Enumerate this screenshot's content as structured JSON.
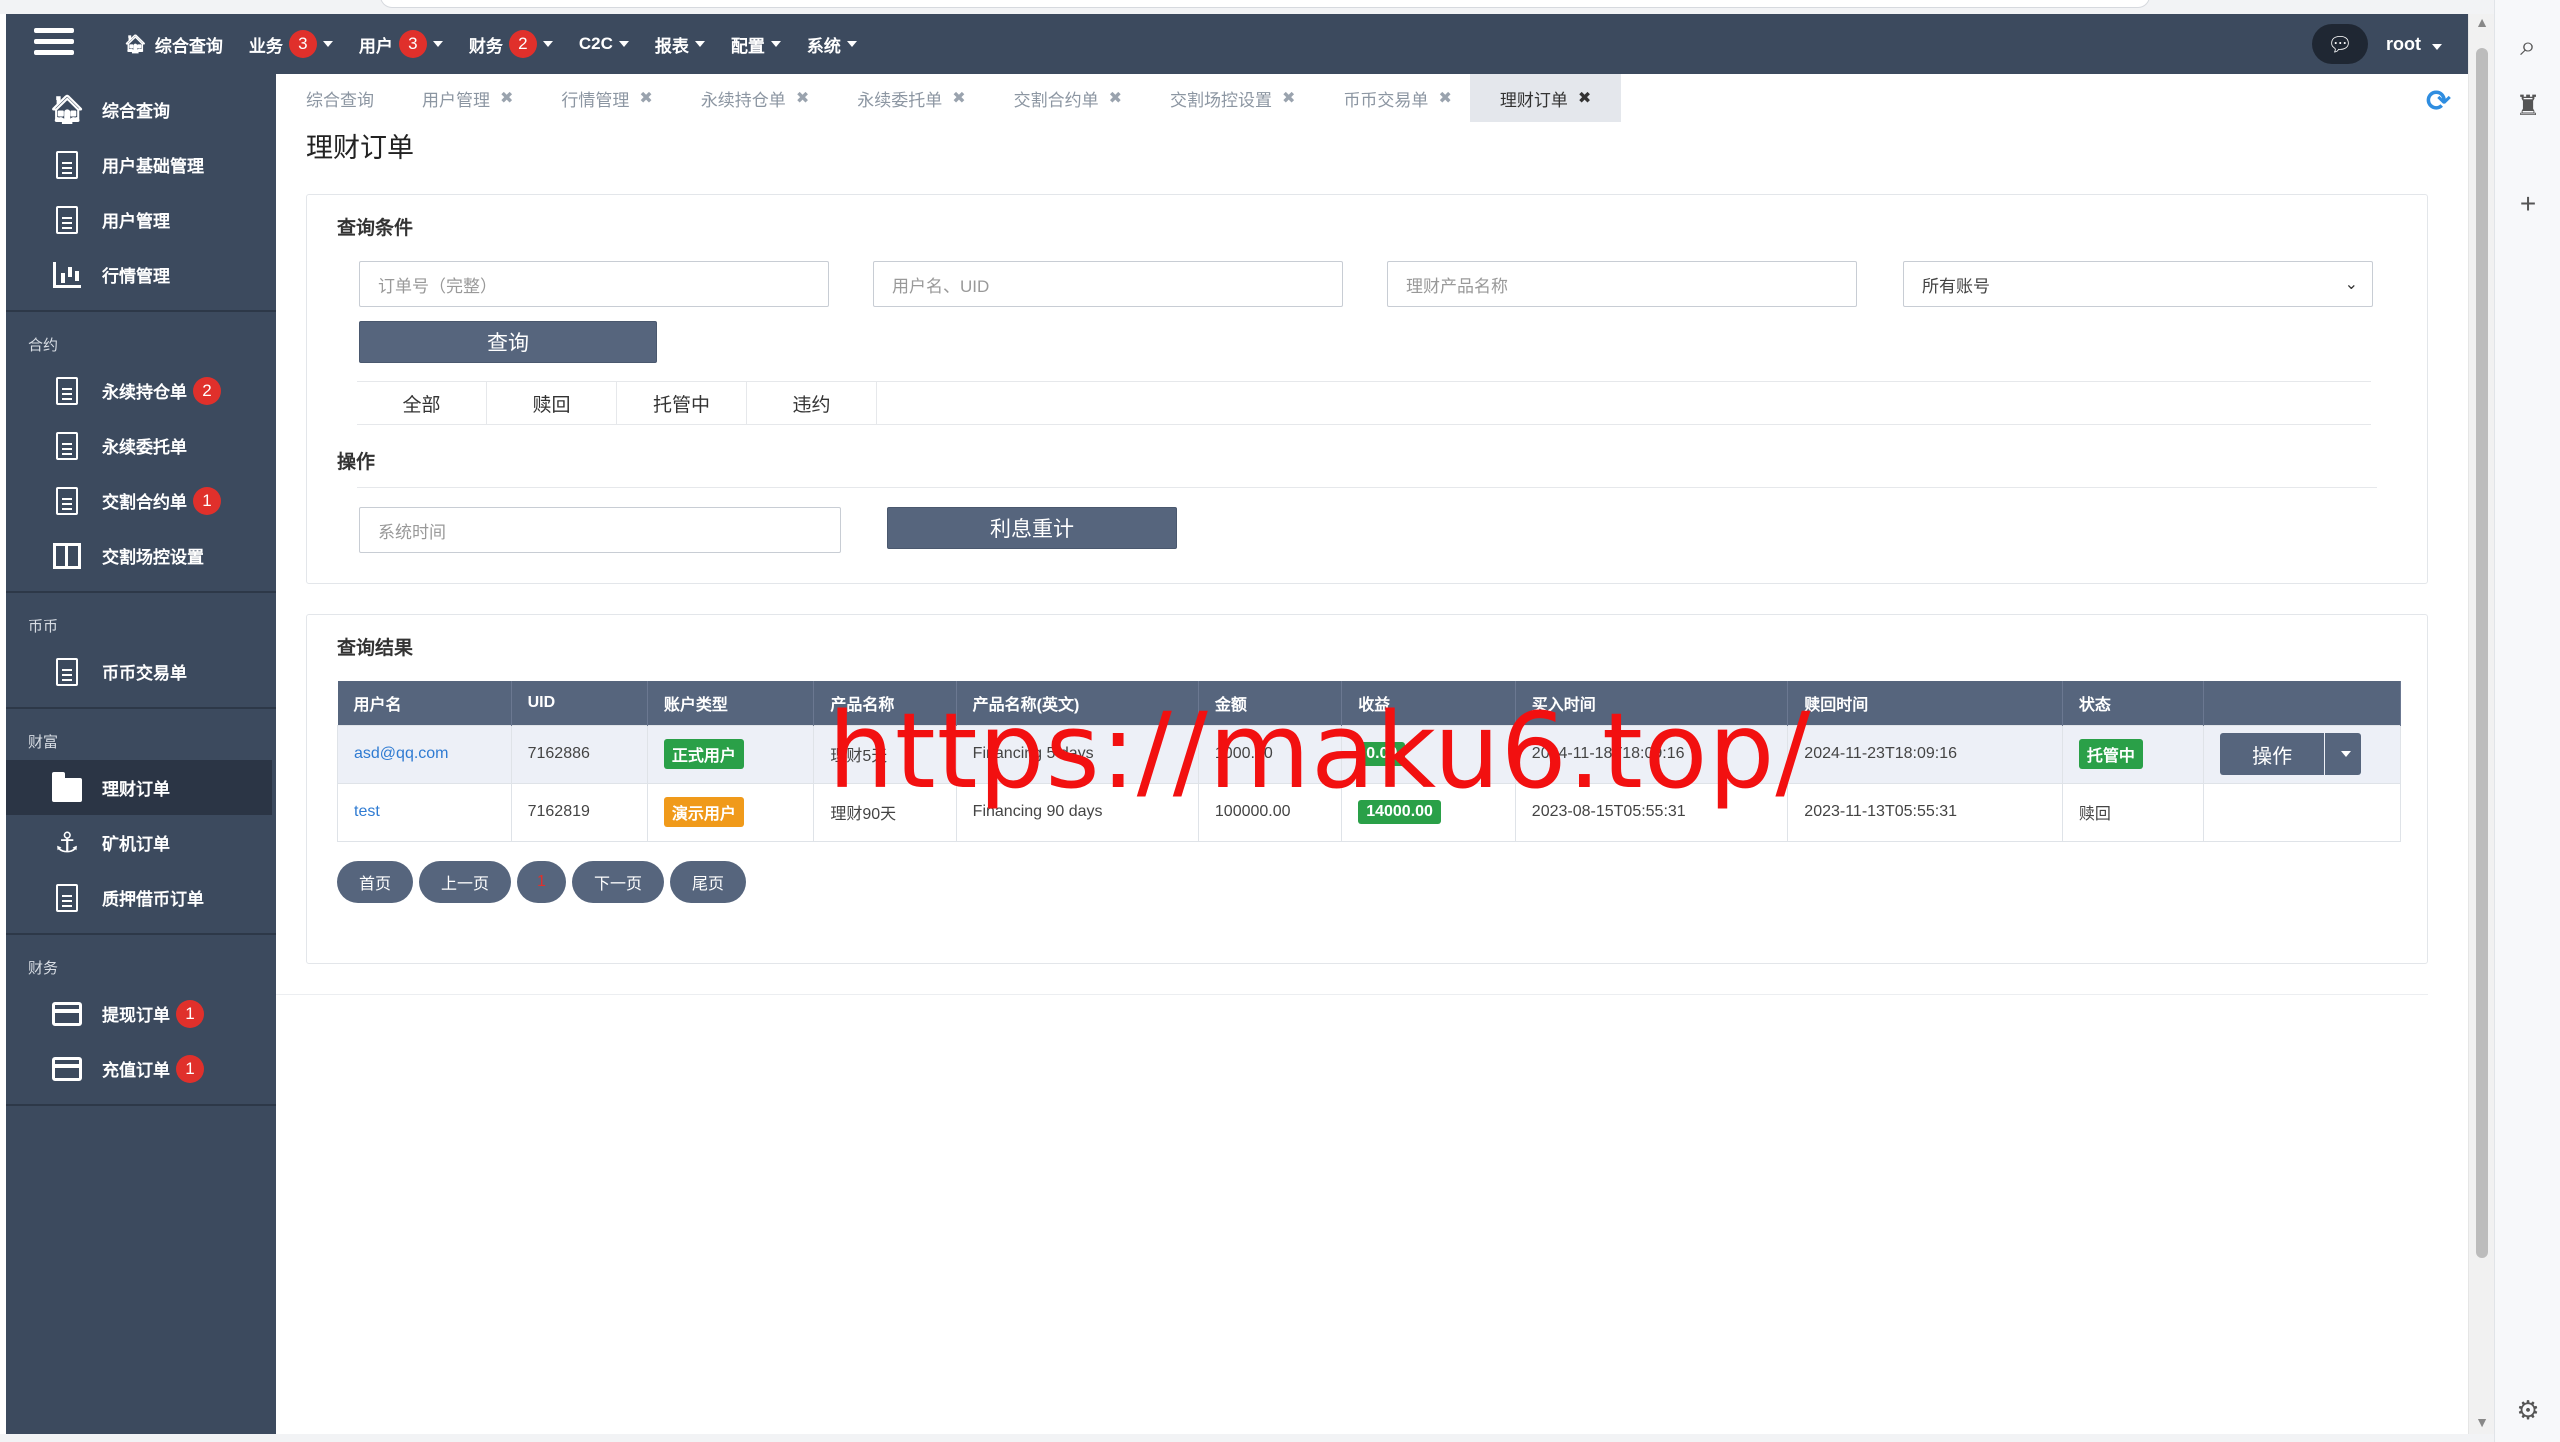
{
  "topnav": {
    "items": [
      {
        "label": "综合查询",
        "badge": null
      },
      {
        "label": "业务",
        "badge": "3"
      },
      {
        "label": "用户",
        "badge": "3"
      },
      {
        "label": "财务",
        "badge": "2"
      },
      {
        "label": "C2C",
        "badge": null
      },
      {
        "label": "报表",
        "badge": null
      },
      {
        "label": "配置",
        "badge": null
      },
      {
        "label": "系统",
        "badge": null
      }
    ],
    "user": "root"
  },
  "sidebar": {
    "group1": [
      {
        "label": "综合查询",
        "icon": "home-icon"
      },
      {
        "label": "用户基础管理",
        "icon": "document-icon"
      },
      {
        "label": "用户管理",
        "icon": "document-icon"
      },
      {
        "label": "行情管理",
        "icon": "bar-chart-icon"
      }
    ],
    "group2_title": "合约",
    "group2": [
      {
        "label": "永续持仓单",
        "badge": "2"
      },
      {
        "label": "永续委托单",
        "badge": null
      },
      {
        "label": "交割合约单",
        "badge": "1"
      },
      {
        "label": "交割场控设置",
        "badge": null
      }
    ],
    "group3_title": "币币",
    "group3": [
      {
        "label": "币币交易单"
      }
    ],
    "group4_title": "财富",
    "group4": [
      {
        "label": "理财订单"
      },
      {
        "label": "矿机订单"
      },
      {
        "label": "质押借币订单"
      }
    ],
    "group5_title": "财务",
    "group5": [
      {
        "label": "提现订单",
        "badge": "1"
      },
      {
        "label": "充值订单",
        "badge": "1"
      }
    ]
  },
  "tabs": [
    "综合查询",
    "用户管理",
    "行情管理",
    "永续持仓单",
    "永续委托单",
    "交割合约单",
    "交割场控设置",
    "币币交易单",
    "理财订单"
  ],
  "page_title": "理财订单",
  "query": {
    "title": "查询条件",
    "order_placeholder": "订单号（完整）",
    "user_placeholder": "用户名、UID",
    "product_placeholder": "理财产品名称",
    "account_select": "所有账号",
    "query_button": "查询",
    "filter_tabs": [
      "全部",
      "赎回",
      "托管中",
      "违约"
    ],
    "ops_title": "操作",
    "time_placeholder": "系统时间",
    "recalc_button": "利息重计"
  },
  "results": {
    "title": "查询结果",
    "columns": [
      "用户名",
      "UID",
      "账户类型",
      "产品名称",
      "产品名称(英文)",
      "金额",
      "收益",
      "买入时间",
      "赎回时间",
      "状态"
    ],
    "rows": [
      {
        "user": "asd@qq.com",
        "uid": "7162886",
        "account_type": "正式用户",
        "product": "理财5天",
        "product_en": "Financing 5 days",
        "amount": "1000.00",
        "profit": "0.00",
        "buy_time": "2024-11-18T18:09:16",
        "redeem_time": "2024-11-23T18:09:16",
        "status": "托管中",
        "op": "操作"
      },
      {
        "user": "test",
        "uid": "7162819",
        "account_type": "演示用户",
        "product": "理财90天",
        "product_en": "Financing 90 days",
        "amount": "100000.00",
        "profit": "14000.00",
        "buy_time": "2023-08-15T05:55:31",
        "redeem_time": "2023-11-13T05:55:31",
        "status": "赎回",
        "op": ""
      }
    ]
  },
  "pager": {
    "first": "首页",
    "prev": "上一页",
    "current": "1",
    "next": "下一页",
    "last": "尾页"
  },
  "watermark": "https://maku6.top/",
  "colors": {
    "header": "#3c4a5e",
    "button": "#56657d",
    "badge": "#e0302b",
    "green": "#2aa048",
    "orange": "#f09a1a",
    "link": "#2f7bd2"
  }
}
